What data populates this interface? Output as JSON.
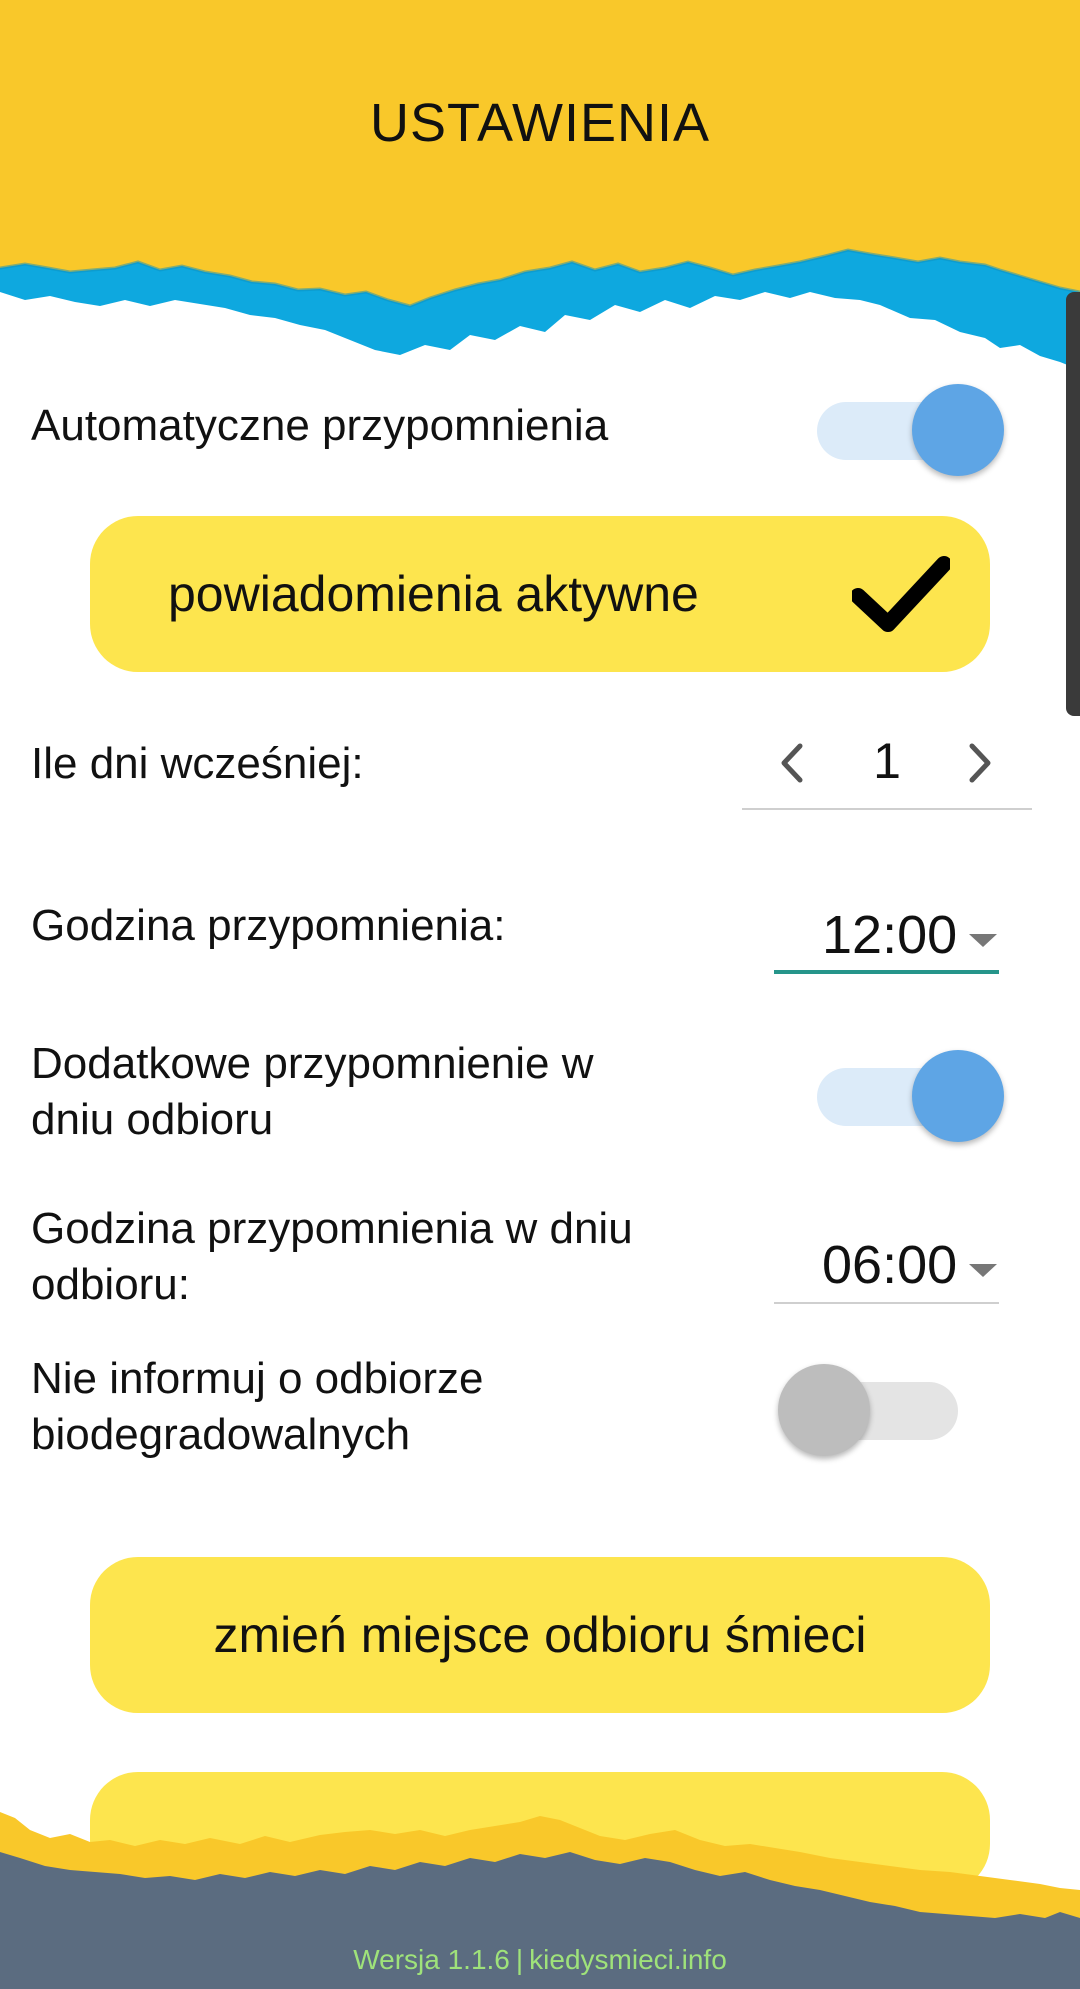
{
  "colors": {
    "header_yellow": "#f9c82a",
    "header_blue": "#0ea8df",
    "button_yellow": "#fde54e",
    "toggle_on": "#5ea5e5",
    "accent_teal": "#26958a",
    "footer_slate": "#5b6c80",
    "footer_text": "#9fe27a"
  },
  "header": {
    "title": "USTAWIENIA"
  },
  "settings": {
    "auto_reminders": {
      "label": "Automatyczne przypomnienia",
      "enabled": true
    },
    "notifications_button": {
      "label": "powiadomienia aktywne",
      "icon": "check-icon"
    },
    "days_before": {
      "label": "Ile dni wcześniej:",
      "value": "1",
      "prev_icon": "chevron-left-icon",
      "next_icon": "chevron-right-icon"
    },
    "reminder_time": {
      "label": "Godzina przypomnienia:",
      "value": "12:00"
    },
    "extra_reminder": {
      "label_line1": "Dodatkowe przypomnienie w",
      "label_line2": "dniu odbioru",
      "enabled": true
    },
    "pickup_day_time": {
      "label_line1": "Godzina przypomnienia w dniu",
      "label_line2": "odbioru:",
      "value": "06:00"
    },
    "skip_bio": {
      "label_line1": "Nie informuj o odbiorze",
      "label_line2": "biodegradowalnych",
      "enabled": false
    },
    "change_location_button": {
      "label": "zmień miejsce odbioru śmieci"
    }
  },
  "footer": {
    "version": "Wersja 1.1.6",
    "separator": "|",
    "site": "kiedysmieci.info"
  }
}
